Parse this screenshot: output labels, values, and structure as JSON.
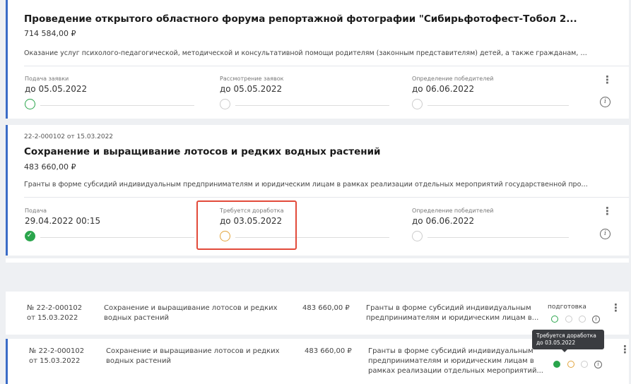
{
  "card1": {
    "title": "Проведение открытого областного форума репортажной фотографии \"Сибирьфотофест-Тобол 2...",
    "amount": "714 584,00 ₽",
    "description": "Оказание услуг психолого-педагогической, методической и консультативной помощи родителям (законным представителям) детей, а также гражданам, желающи...",
    "stages": [
      {
        "label": "Подача заявки",
        "date": "до 05.05.2022",
        "status": "green-outline"
      },
      {
        "label": "Рассмотрение заявок",
        "date": "до 05.05.2022",
        "status": "empty"
      },
      {
        "label": "Определение победителей",
        "date": "до 06.06.2022",
        "status": "empty"
      }
    ]
  },
  "card2": {
    "number": "22-2-000102 от 15.03.2022",
    "title": "Сохранение и выращивание лотосов и редких водных растений",
    "amount": "483 660,00 ₽",
    "description": "Гранты в форме субсидий индивидуальным предпринимателям и юридическим лицам в рамках реализации отдельных мероприятий государственной программы...",
    "stages": [
      {
        "label": "Подача",
        "date": "29.04.2022 00:15",
        "status": "green-filled"
      },
      {
        "label": "Требуется доработка",
        "date": "до 03.05.2022",
        "status": "orange-outline"
      },
      {
        "label": "Определение победителей",
        "date": "до 06.06.2022",
        "status": "empty"
      }
    ]
  },
  "rows": [
    {
      "number": "№ 22-2-000102",
      "date": "от 15.03.2022",
      "name_line1": "Сохранение и выращивание лотосов и редких",
      "name_line2": "водных растений",
      "amount": "483 660,00 ₽",
      "desc_line1": "Гранты в форме субсидий индивидуальным",
      "desc_line2": "предпринимателям и юридическим лицам в...",
      "status": "подготовка"
    },
    {
      "number": "№ 22-2-000102",
      "date": "от 15.03.2022",
      "name_line1": "Сохранение и выращивание лотосов и редких",
      "name_line2": "водных растений",
      "amount": "483 660,00 ₽",
      "desc_line1": "Гранты в форме субсидий индивидуальным",
      "desc_line2": "предпринимателям и юридическим лицам в",
      "desc_line3": "рамках реализации отдельных мероприятий...",
      "tooltip_line1": "Требуется доработка",
      "tooltip_line2": "до 03.05.2022"
    }
  ],
  "icons": {
    "kebab": "⋮",
    "info": "i",
    "check": "✓"
  },
  "colors": {
    "accent": "#3b6cc7",
    "green": "#2aa54c",
    "orange": "#e2a43c",
    "highlight": "#e24a3a"
  }
}
